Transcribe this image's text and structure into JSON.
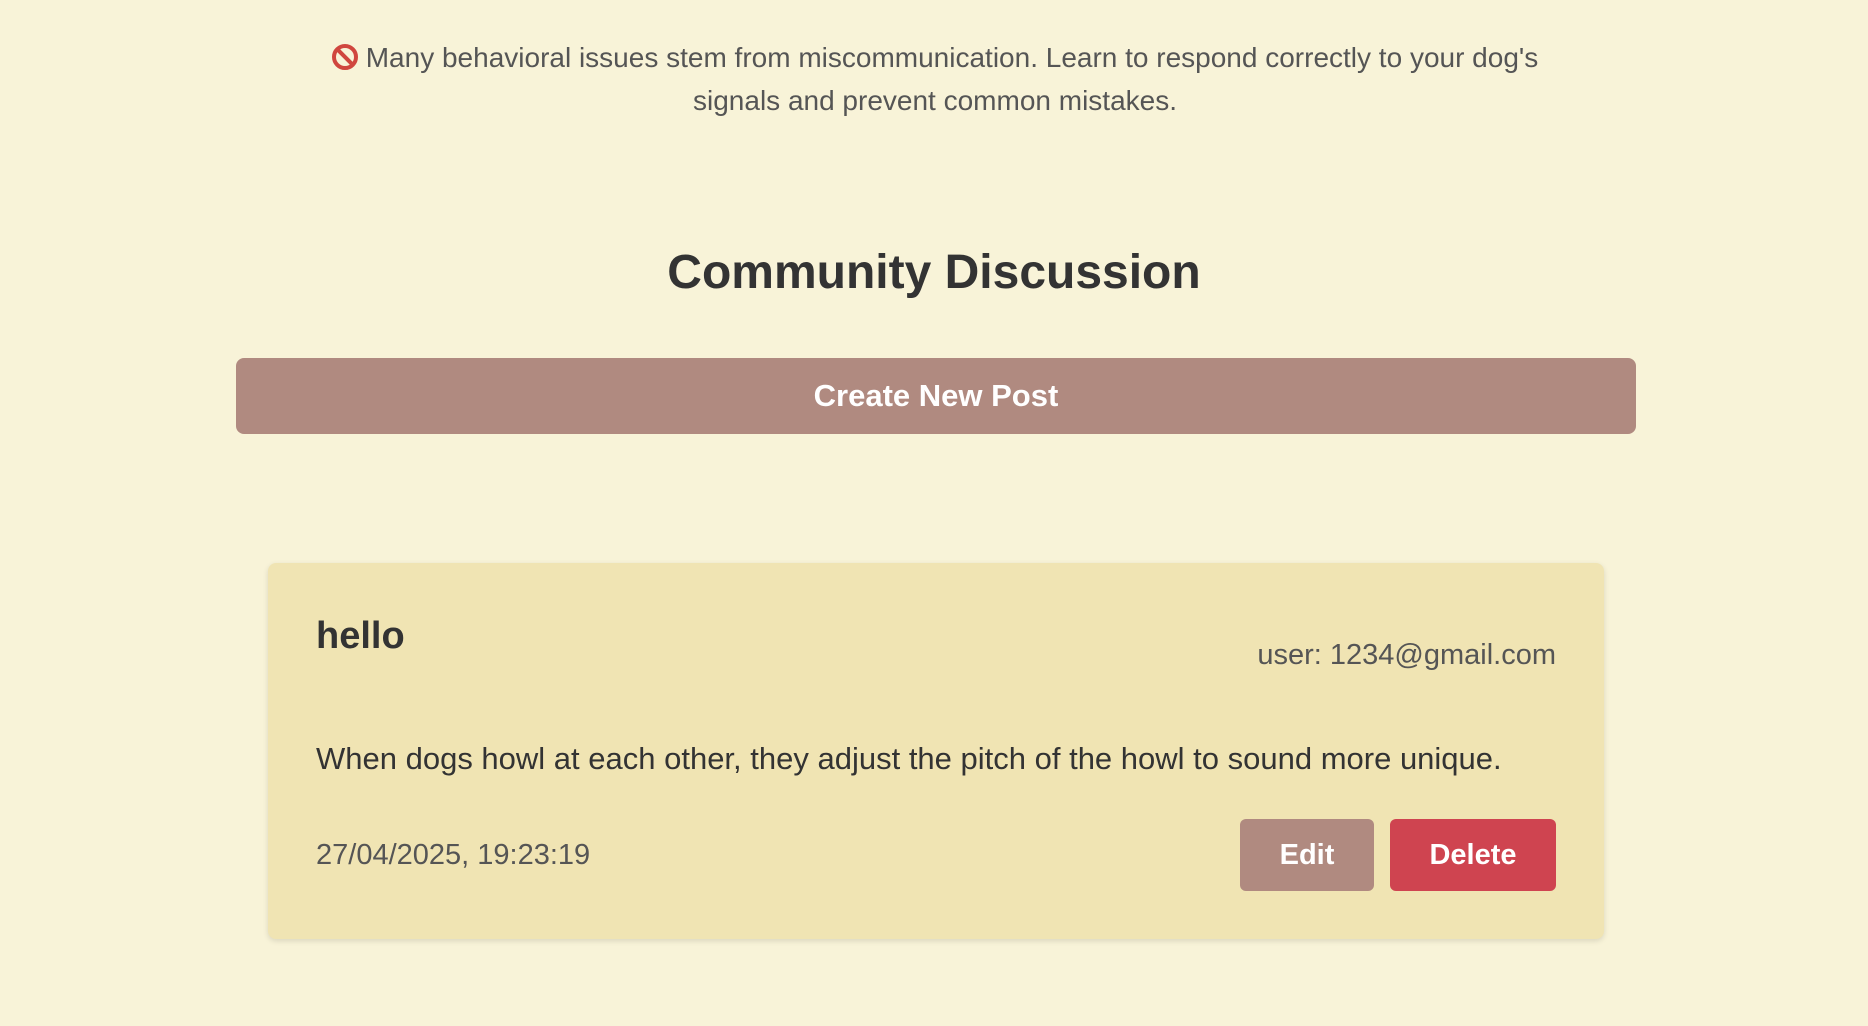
{
  "intro": {
    "text": "Many behavioral issues stem from miscommunication. Learn to respond correctly to your dog's signals and prevent common mistakes."
  },
  "icons": {
    "intro_icon": "no-entry-icon"
  },
  "community": {
    "title": "Community Discussion",
    "create_button_label": "Create New Post"
  },
  "posts": [
    {
      "title": "hello",
      "user": "user: 1234@gmail.com",
      "body": "When dogs howl at each other, they adjust the pitch of the howl to sound more unique.",
      "date": "27/04/2025, 19:23:19",
      "edit_label": "Edit",
      "delete_label": "Delete"
    }
  ],
  "colors": {
    "background": "#f8f3d8",
    "card": "#f0e4b3",
    "primary_button": "#b08a80",
    "delete_button": "#cf4450",
    "no_entry_icon": "#d0463e"
  }
}
